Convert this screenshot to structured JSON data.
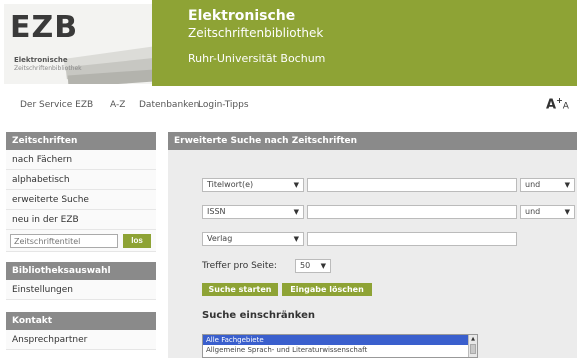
{
  "logo": {
    "mark": "EZB",
    "line1": "Elektronische",
    "line2": "Zeitschriftenbibliothek"
  },
  "banner": {
    "title_line1": "Elektronische",
    "title_line2": "Zeitschriftenbibliothek",
    "institution": "Ruhr-Universität Bochum"
  },
  "topnav": {
    "items": [
      "Der Service EZB",
      "A-Z",
      "Datenbanken",
      "Login-Tipps"
    ],
    "font_size_big": "A",
    "font_size_sup": "+",
    "font_size_small": "A"
  },
  "sidebar": {
    "section1": {
      "title": "Zeitschriften",
      "items": [
        "nach Fächern",
        "alphabetisch",
        "erweiterte Suche",
        "neu in der EZB"
      ]
    },
    "quick_search": {
      "placeholder": "Zeitschriftentitel",
      "button": "los"
    },
    "section2": {
      "title": "Bibliotheksauswahl",
      "items": [
        "Einstellungen"
      ]
    },
    "section3": {
      "title": "Kontakt",
      "items": [
        "Ansprechpartner"
      ]
    }
  },
  "main": {
    "heading": "Erweiterte Suche nach Zeitschriften",
    "rows": [
      {
        "field": "Titelwort(e)",
        "operator": "und"
      },
      {
        "field": "ISSN",
        "operator": "und"
      },
      {
        "field": "Verlag",
        "operator": ""
      }
    ],
    "per_page_label": "Treffer pro Seite:",
    "per_page_value": "50",
    "search_button": "Suche starten",
    "clear_button": "Eingabe löschen",
    "restrict_heading": "Suche einschränken",
    "subject_options": [
      "Alle Fachgebiete",
      "Allgemeine Sprach- und Literaturwissenschaft"
    ]
  },
  "colors": {
    "brand_green": "#8ea335",
    "header_gray": "#8a8a8a",
    "panel_bg": "#ececec"
  }
}
